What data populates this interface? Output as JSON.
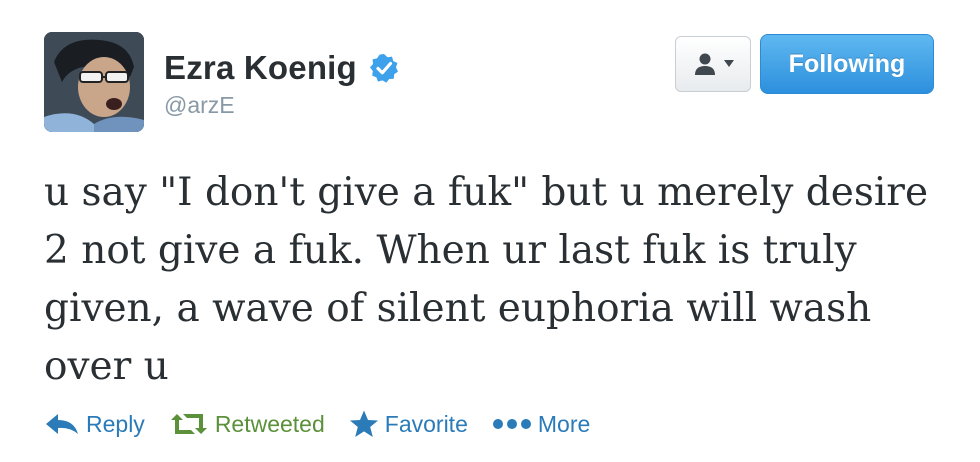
{
  "tweet": {
    "author": {
      "name": "Ezra Koenig",
      "handle": "@arzE",
      "verified": true
    },
    "buttons": {
      "user_dropdown_icon": "person-caret-icon",
      "follow_label": "Following"
    },
    "text": "u say \"I don't give a fuk\" but u merely desire\n2 not give a fuk. When ur last fuk is truly\ngiven, a wave of silent euphoria will wash\nover u",
    "actions": {
      "reply": "Reply",
      "retweeted": "Retweeted",
      "favorite": "Favorite",
      "more": "More"
    }
  },
  "colors": {
    "link_blue": "#2b7bb9",
    "retweet_green": "#5c913b",
    "follow_button": "#2d90dd",
    "handle_gray": "#8899a6"
  }
}
